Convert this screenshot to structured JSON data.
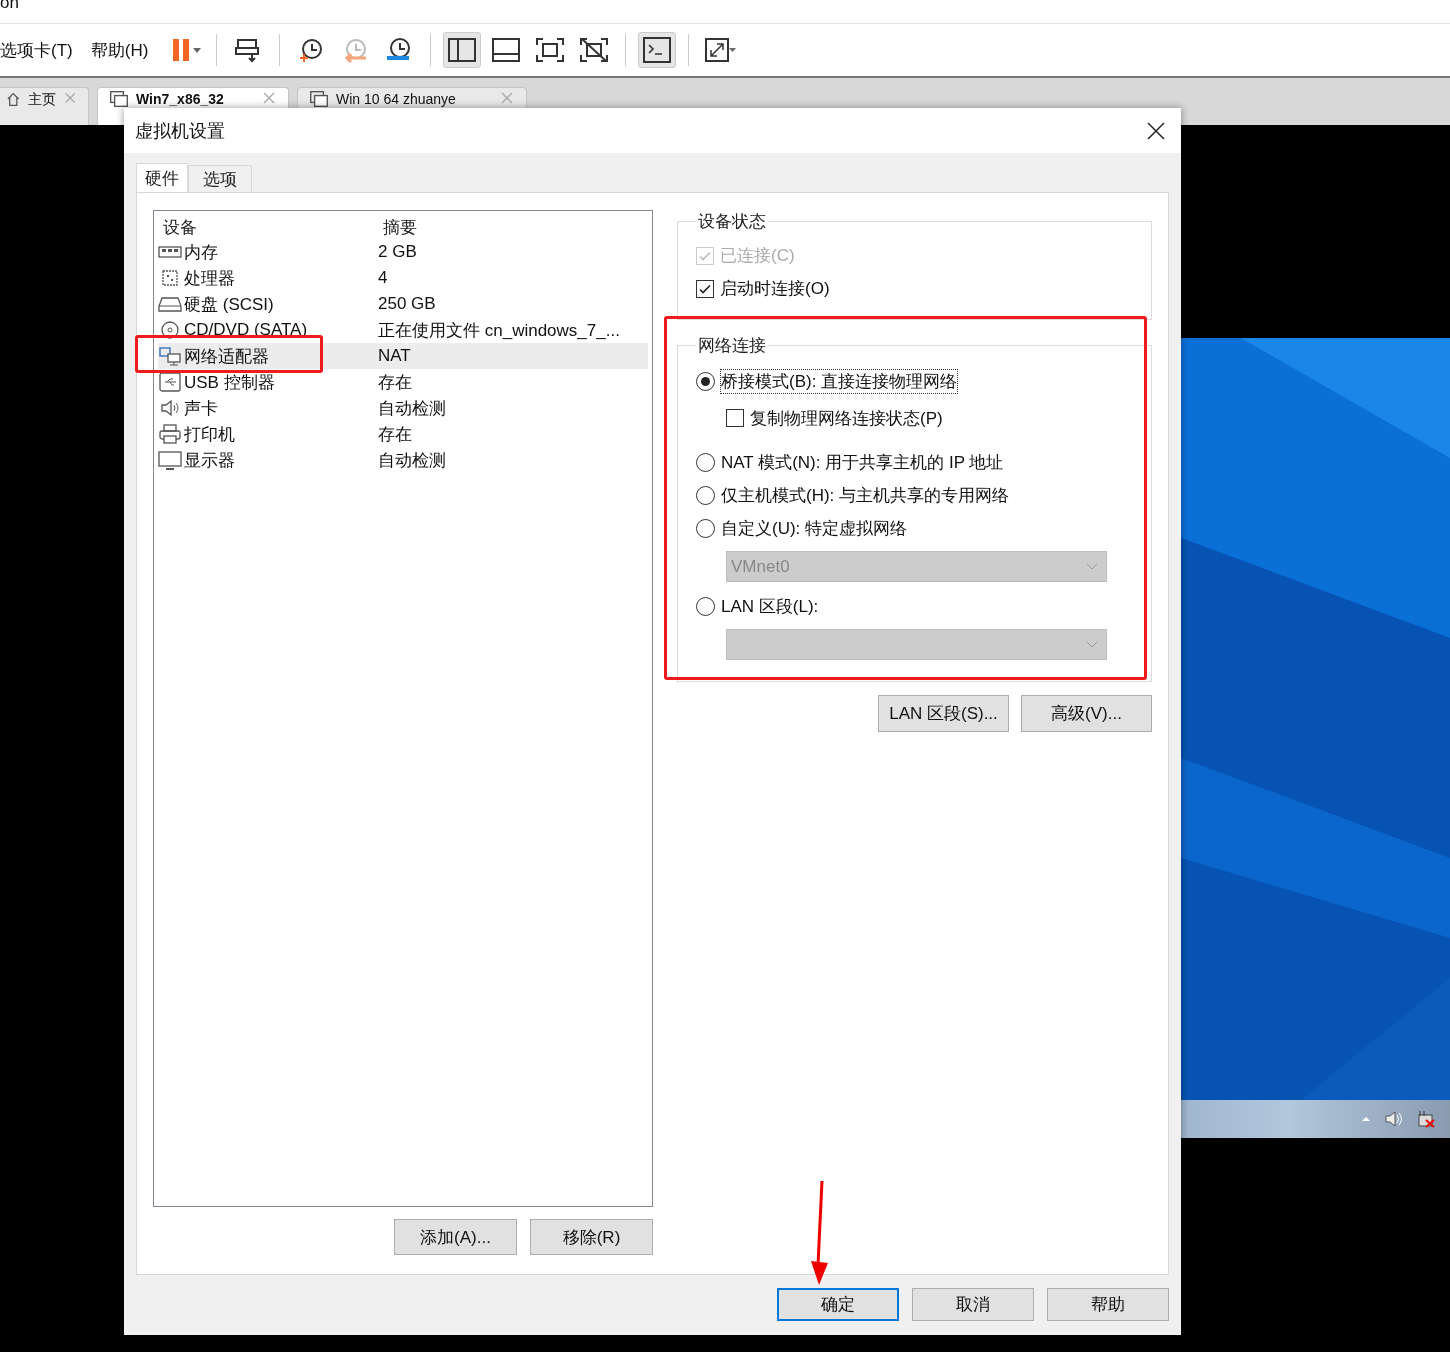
{
  "app_title": "on",
  "menu": [
    "选项卡(T)",
    "帮助(H)"
  ],
  "toolbar": [
    {
      "kind": "pause",
      "pressed": false
    },
    {
      "kind": "send-keys",
      "pressed": false
    },
    {
      "kind": "snapshot",
      "pressed": false
    },
    {
      "kind": "revert",
      "pressed": false
    },
    {
      "kind": "manage-snapshots",
      "pressed": false
    },
    {
      "kind": "library",
      "pressed": true
    },
    {
      "kind": "thumbnails",
      "pressed": false
    },
    {
      "kind": "fullscreen",
      "pressed": false
    },
    {
      "kind": "unity",
      "pressed": false
    },
    {
      "kind": "console",
      "pressed": true
    },
    {
      "kind": "stretch",
      "pressed": false
    }
  ],
  "tabs": [
    {
      "label": "主页",
      "kind": "home",
      "selected": false
    },
    {
      "label": "Win7_x86_32",
      "kind": "vm",
      "selected": true
    },
    {
      "label": "Win 10 64 zhuanye",
      "kind": "vm",
      "selected": false
    }
  ],
  "dialog": {
    "title": "虚拟机设置",
    "tabs": [
      {
        "label": "硬件",
        "selected": true
      },
      {
        "label": "选项",
        "selected": false
      }
    ],
    "columns": [
      "设备",
      "摘要"
    ],
    "devices": [
      {
        "kind": "memory",
        "name": "内存",
        "summary": "2 GB",
        "selected": false
      },
      {
        "kind": "cpu",
        "name": "处理器",
        "summary": "4",
        "selected": false
      },
      {
        "kind": "disk",
        "name": "硬盘 (SCSI)",
        "summary": "250 GB",
        "selected": false
      },
      {
        "kind": "cdrom",
        "name": "CD/DVD (SATA)",
        "summary": "正在使用文件 cn_windows_7_...",
        "selected": false
      },
      {
        "kind": "network",
        "name": "网络适配器",
        "summary": "NAT",
        "selected": true
      },
      {
        "kind": "usb",
        "name": "USB 控制器",
        "summary": "存在",
        "selected": false
      },
      {
        "kind": "sound",
        "name": "声卡",
        "summary": "自动检测",
        "selected": false
      },
      {
        "kind": "printer",
        "name": "打印机",
        "summary": "存在",
        "selected": false
      },
      {
        "kind": "display",
        "name": "显示器",
        "summary": "自动检测",
        "selected": false
      }
    ],
    "list_buttons": [
      "添加(A)...",
      "移除(R)"
    ],
    "device_status": {
      "title": "设备状态",
      "options": [
        {
          "label": "已连接(C)",
          "checked": true,
          "disabled": true
        },
        {
          "label": "启动时连接(O)",
          "checked": true,
          "disabled": false
        }
      ]
    },
    "network": {
      "title": "网络连接",
      "options": [
        {
          "kind": "radio",
          "label": "桥接模式(B): 直接连接物理网络",
          "selected": true,
          "focused": true
        },
        {
          "kind": "checkbox",
          "label": "复制物理网络连接状态(P)",
          "checked": false
        },
        {
          "kind": "radio",
          "label": "NAT 模式(N): 用于共享主机的 IP 地址",
          "selected": false,
          "focused": false
        },
        {
          "kind": "radio",
          "label": "仅主机模式(H): 与主机共享的专用网络",
          "selected": false,
          "focused": false
        },
        {
          "kind": "radio",
          "label": "自定义(U): 特定虚拟网络",
          "selected": false,
          "focused": false
        },
        {
          "kind": "dropdown",
          "value": "VMnet0"
        },
        {
          "kind": "radio",
          "label": "LAN 区段(L):",
          "selected": false,
          "focused": false
        },
        {
          "kind": "dropdown"
        }
      ]
    },
    "network_buttons": [
      "LAN 区段(S)...",
      "高级(V)..."
    ],
    "footer_buttons": [
      {
        "label": "确定",
        "default": true
      },
      {
        "label": "取消",
        "default": false
      },
      {
        "label": "帮助",
        "default": false
      }
    ]
  }
}
